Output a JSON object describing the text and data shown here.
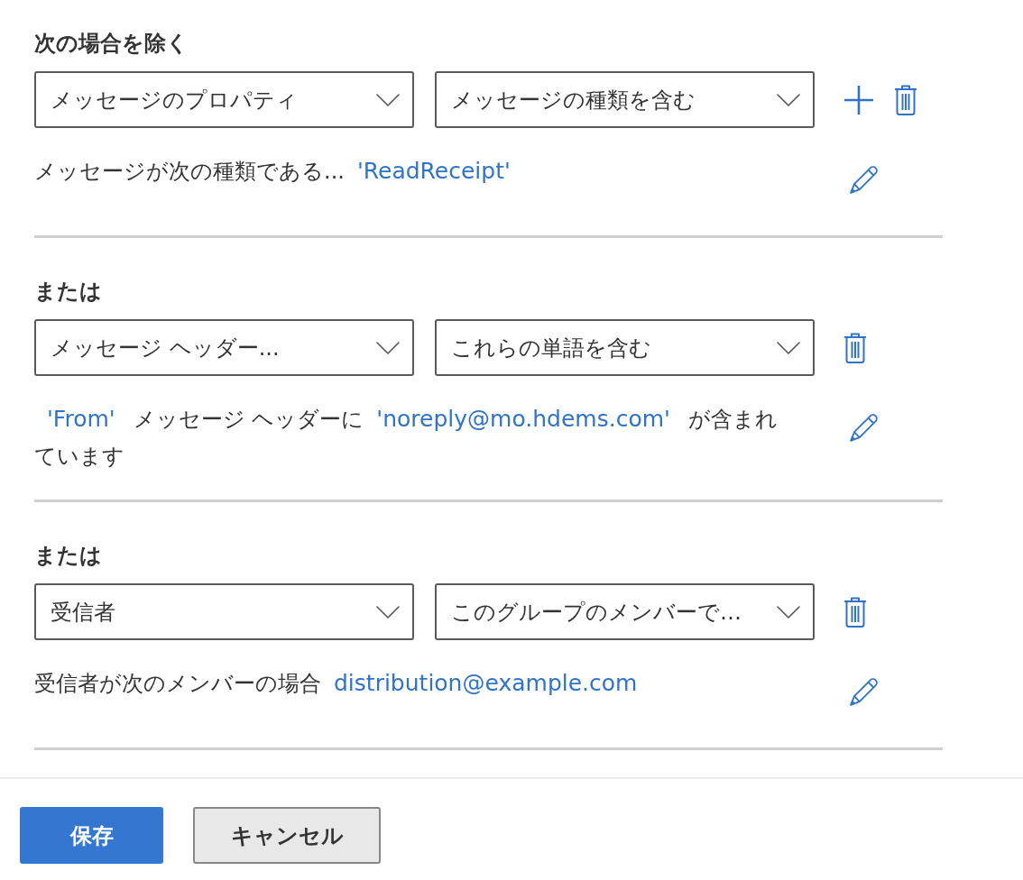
{
  "sections": [
    {
      "heading": "次の場合を除く",
      "dropdowns": [
        {
          "value": "メッセージのプロパティ"
        },
        {
          "value": "メッセージの種類を含む"
        }
      ],
      "actions": [
        {
          "kind": "add"
        },
        {
          "kind": "delete"
        }
      ],
      "description": [
        {
          "kind": "text",
          "text": "メッセージが次の種類である..."
        },
        {
          "kind": "value",
          "text": "'ReadReceipt'"
        }
      ]
    },
    {
      "heading": "または",
      "dropdowns": [
        {
          "value": "メッセージ ヘッダー..."
        },
        {
          "value": "これらの単語を含む"
        }
      ],
      "actions": [
        {
          "kind": "delete"
        }
      ],
      "description": [
        {
          "kind": "value",
          "text": "'From'"
        },
        {
          "kind": "text",
          "text": "メッセージ ヘッダーに"
        },
        {
          "kind": "value",
          "text": "'noreply@mo.hdems.com'"
        },
        {
          "kind": "text",
          "text": "が含まれています"
        }
      ]
    },
    {
      "heading": "または",
      "dropdowns": [
        {
          "value": "受信者"
        },
        {
          "value": "このグループのメンバーで…"
        }
      ],
      "actions": [
        {
          "kind": "delete"
        }
      ],
      "description": [
        {
          "kind": "text",
          "text": "受信者が次のメンバーの場合"
        },
        {
          "kind": "value",
          "text": "distribution@example.com"
        }
      ]
    }
  ],
  "buttons": [
    {
      "kind": "primary",
      "label": "保存"
    },
    {
      "kind": "secondary",
      "label": "キャンセル"
    }
  ]
}
